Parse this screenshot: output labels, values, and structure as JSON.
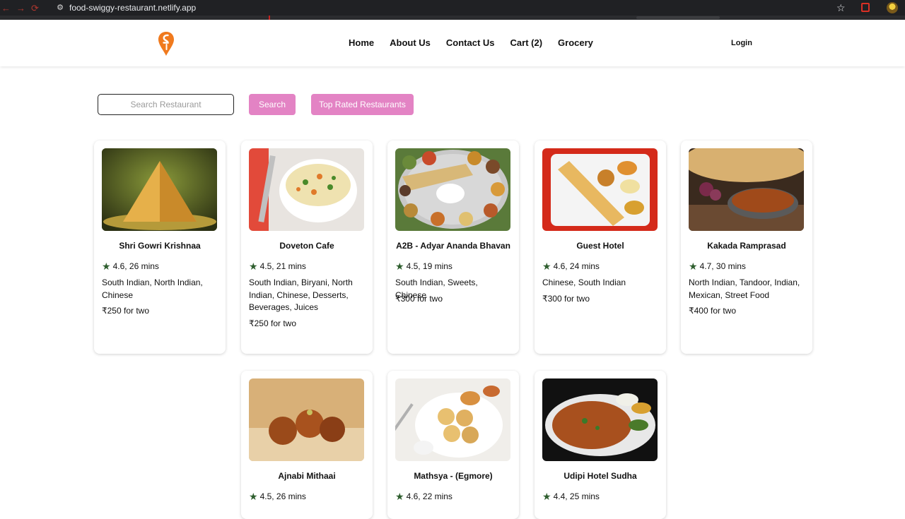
{
  "browser": {
    "url": "food-swiggy-restaurant.netlify.app"
  },
  "header": {
    "logo": "swiggy-logo-icon",
    "nav": [
      "Home",
      "About Us",
      "Contact Us",
      "Cart (2)",
      "Grocery"
    ],
    "login_label": "Login"
  },
  "filters": {
    "search_placeholder": "Search Restaurant",
    "search_button": "Search",
    "top_rated_button": "Top Rated Restaurants"
  },
  "colors": {
    "accent_button": "#e383c4",
    "rating_star": "#2e5e2e",
    "logo_orange": "#f07a1e"
  },
  "restaurants": [
    {
      "name": "Shri Gowri Krishnaa",
      "rating": "4.6, 26 mins",
      "cuisines": "South Indian, North Indian, Chinese",
      "cost": "₹250 for two"
    },
    {
      "name": "Doveton Cafe",
      "rating": "4.5, 21 mins",
      "cuisines": "South Indian, Biryani, North Indian, Chinese, Desserts, Beverages, Juices",
      "cost": "₹250 for two"
    },
    {
      "name": "A2B - Adyar Ananda Bhavan",
      "rating": "4.5, 19 mins",
      "cuisines": "South Indian, Sweets, Chinese",
      "cost": "₹300 for two"
    },
    {
      "name": "Guest Hotel",
      "rating": "4.6, 24 mins",
      "cuisines": "Chinese, South Indian",
      "cost": "₹300 for two"
    },
    {
      "name": "Kakada Ramprasad",
      "rating": "4.7, 30 mins",
      "cuisines": "North Indian, Tandoor, Indian, Mexican, Street Food",
      "cost": "₹400 for two"
    },
    {
      "name": "Ajnabi Mithaai",
      "rating": "4.5, 26 mins",
      "cuisines": "",
      "cost": ""
    },
    {
      "name": "Mathsya - (Egmore)",
      "rating": "4.6, 22 mins",
      "cuisines": "",
      "cost": ""
    },
    {
      "name": "Udipi Hotel Sudha",
      "rating": "4.4, 25 mins",
      "cuisines": "",
      "cost": ""
    }
  ]
}
